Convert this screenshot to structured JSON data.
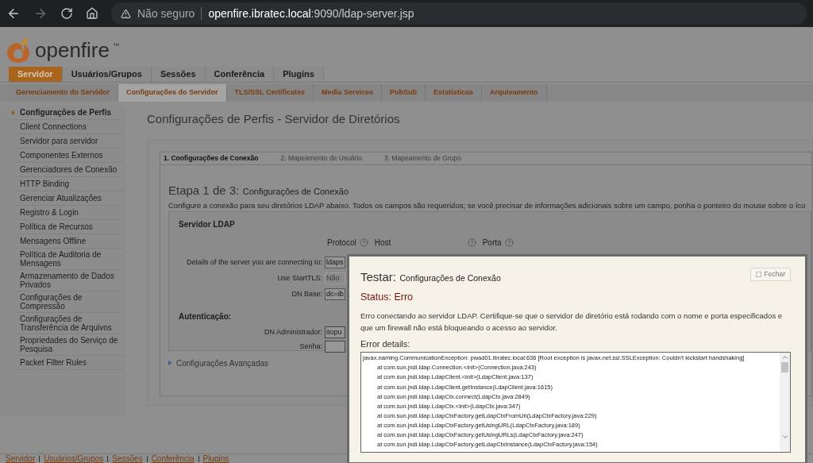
{
  "browser": {
    "security": "Não seguro",
    "url_host": "openfire.ibratec.local",
    "url_rest": ":9090/ldap-server.jsp"
  },
  "logo": {
    "text": "openfire",
    "mark": "™"
  },
  "main_tabs": [
    {
      "label": "Servidor",
      "selected": true
    },
    {
      "label": "Usuários/Grupos",
      "selected": false
    },
    {
      "label": "Sessões",
      "selected": false
    },
    {
      "label": "Conferência",
      "selected": false
    },
    {
      "label": "Plugins",
      "selected": false
    }
  ],
  "sub_tabs": [
    {
      "label": "Gerenciamento do Servidor",
      "selected": false
    },
    {
      "label": "Configurações do Servidor",
      "selected": true
    },
    {
      "label": "TLS/SSL Certificates",
      "selected": false
    },
    {
      "label": "Media Services",
      "selected": false
    },
    {
      "label": "PubSub",
      "selected": false
    },
    {
      "label": "Estatísticas",
      "selected": false
    },
    {
      "label": "Arquivamento",
      "selected": false
    }
  ],
  "sidebar": {
    "items": [
      {
        "label": "Configurações de Perfis",
        "selected": true
      },
      {
        "label": "Client Connections",
        "selected": false
      },
      {
        "label": "Servidor para servidor",
        "selected": false
      },
      {
        "label": "Componentes Externos",
        "selected": false
      },
      {
        "label": "Gerenciadores de Conexão",
        "selected": false
      },
      {
        "label": "HTTP Binding",
        "selected": false
      },
      {
        "label": "Gerenciar Atualizações",
        "selected": false
      },
      {
        "label": "Registro & Login",
        "selected": false
      },
      {
        "label": "Política de Recursos",
        "selected": false
      },
      {
        "label": "Mensagens Offline",
        "selected": false
      },
      {
        "label": "Política de Auditoria de Mensagens",
        "selected": false
      },
      {
        "label": "Armazenamento de Dados Privados",
        "selected": false
      },
      {
        "label": "Configurações de Compressão",
        "selected": false
      },
      {
        "label": "Configurações de Transferência de Arquivos",
        "selected": false
      },
      {
        "label": "Propriedades do Serviço de Pesquisa",
        "selected": false
      },
      {
        "label": "Packet Filter Rules",
        "selected": false
      }
    ]
  },
  "page_title": "Configurações de Perfis - Servidor de Diretórios",
  "wizard": {
    "steps": [
      {
        "label": "1. Configurações de Conexão",
        "selected": true
      },
      {
        "label": "2. Mapeamento de Usuário",
        "selected": false
      },
      {
        "label": "3. Mapeamento de Grupo",
        "selected": false
      }
    ],
    "heading_prefix": "Etapa 1 de 3:",
    "heading": "Configurações de Conexão",
    "description": "Configure a conexão para seu diretórios LDAP abaixo. Todos os campos são requeridos; se você precisar de informações adicionais sobre um campo, ponha o ponteiro do mouse sobre o íco",
    "server_section": {
      "title": "Servidor LDAP",
      "column_headers": [
        "Protocol",
        "Host",
        "Porta"
      ],
      "fields": [
        {
          "label": "Details of the server you are connecting to:",
          "value": "ldaps",
          "disabled": false
        },
        {
          "label": "Use StartTLS:",
          "value": "Não",
          "disabled": true
        },
        {
          "label": "DN Base:",
          "value": "dc=ib",
          "disabled": false
        }
      ]
    },
    "auth_section": {
      "title": "Autenticação:",
      "fields": [
        {
          "label": "DN Administrador:",
          "value": "itopu",
          "disabled": false
        },
        {
          "label": "Senha:",
          "disabled": false
        }
      ]
    },
    "advanced": {
      "label": "Configurações Avançadas",
      "expanded": false
    }
  },
  "footer_links": [
    "Servidor",
    "Usuários/Grupos",
    "Sessões",
    "Conferência",
    "Plugins"
  ],
  "dialog": {
    "title_prefix": "Testar:",
    "title": "Configurações de Conexão",
    "close_label": "Fechar",
    "status": "Status: Erro",
    "message": "Erro conectando ao servidor LDAP. Certifique-se que o servidor de diretório está rodando com o nome e porta especificados e que um firewall não está bloqueando o acesso ao servidor.",
    "details_label": "Error details:",
    "details_lines": [
      "javax.naming.CommunicationException: pwad01.ibratec.local:636 [Root exception is javax.net.ssl.SSLException: Couldn't kickstart handshaking]",
      "at com.sun.jndi.ldap.Connection.<init>(Connection.java:243)",
      "at com.sun.jndi.ldap.LdapClient.<init>(LdapClient.java:137)",
      "at com.sun.jndi.ldap.LdapClient.getInstance(LdapClient.java:1615)",
      "at com.sun.jndi.ldap.LdapCtx.connect(LdapCtx.java:2849)",
      "at com.sun.jndi.ldap.LdapCtx.<init>(LdapCtx.java:347)",
      "at com.sun.jndi.ldap.LdapCtxFactory.getLdapCtxFromUrl(LdapCtxFactory.java:229)",
      "at com.sun.jndi.ldap.LdapCtxFactory.getUsingURL(LdapCtxFactory.java:189)",
      "at com.sun.jndi.ldap.LdapCtxFactory.getUsingURLs(LdapCtxFactory.java:247)",
      "at com.sun.jndi.ldap.LdapCtxFactory.getLdapCtxInstance(LdapCtxFactory.java:154)"
    ]
  }
}
